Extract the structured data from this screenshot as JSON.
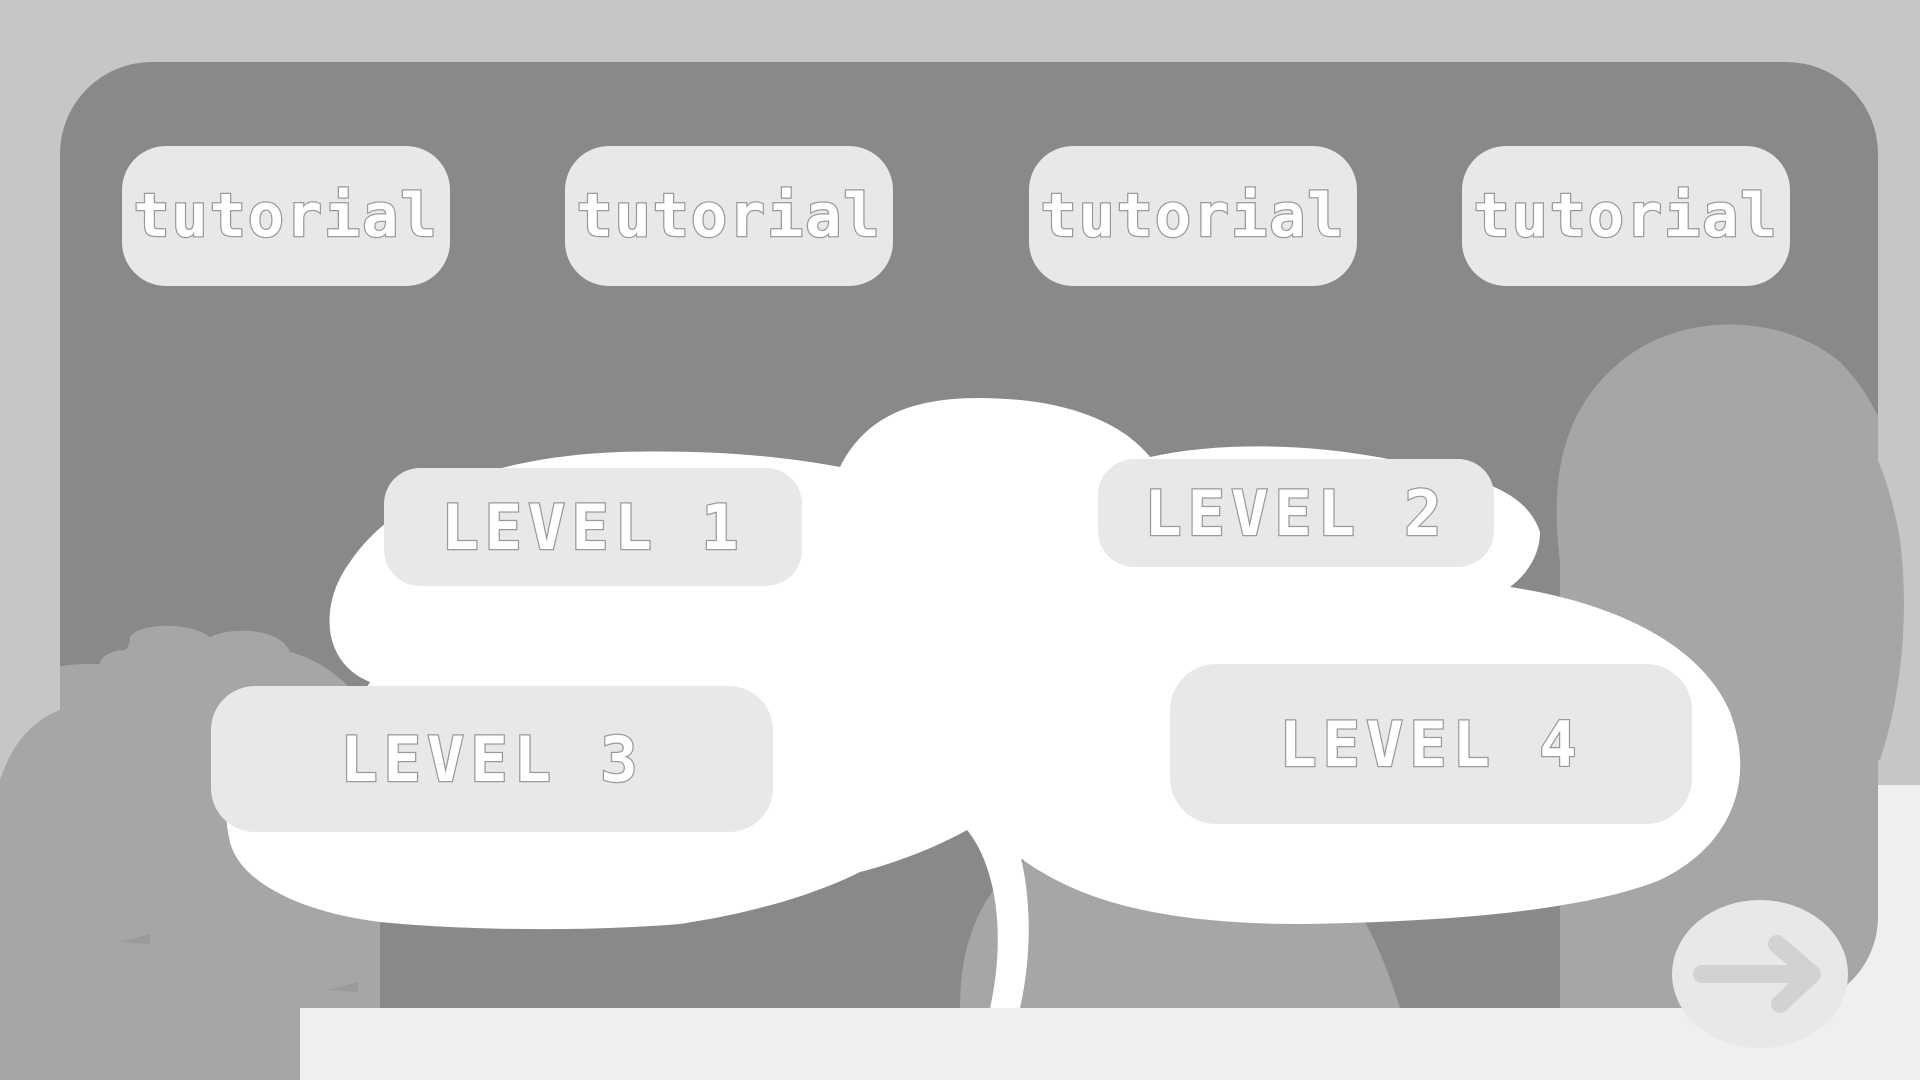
{
  "screen": "level-select",
  "colors": {
    "background": "#c6c6c6",
    "panel": "#898989",
    "button_fill": "#e8e8e8",
    "label_outline": "#9a9a9a",
    "cloud": "#ffffff",
    "hill": "#a6a6a6"
  },
  "tutorials": [
    {
      "label": "tutorial"
    },
    {
      "label": "tutorial"
    },
    {
      "label": "tutorial"
    },
    {
      "label": "tutorial"
    }
  ],
  "levels": [
    {
      "label": "LEVEL 1"
    },
    {
      "label": "LEVEL 2"
    },
    {
      "label": "LEVEL 3"
    },
    {
      "label": "LEVEL 4"
    }
  ],
  "next_button": {
    "icon": "arrow-right-icon"
  }
}
